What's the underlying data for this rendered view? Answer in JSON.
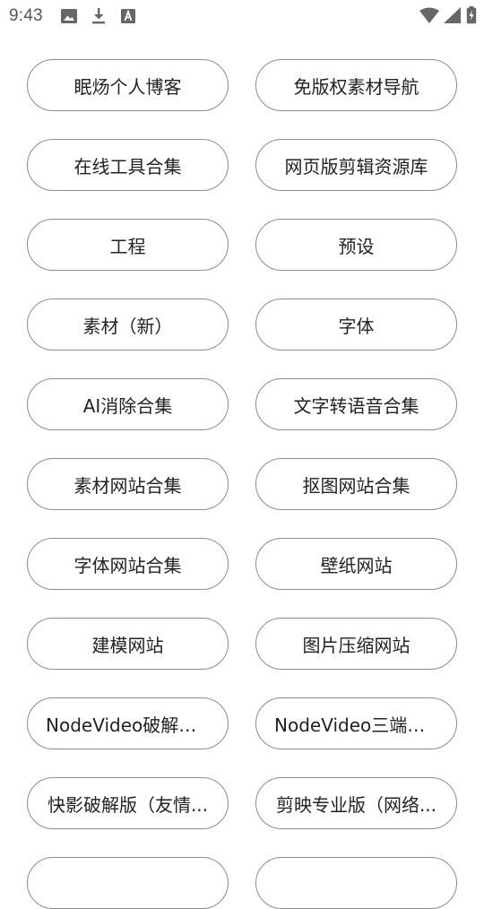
{
  "status_bar": {
    "time": "9:43",
    "left_icons": [
      "image-icon",
      "download-icon",
      "font-a-icon"
    ],
    "right_icons": [
      "wifi-icon",
      "signal-icon",
      "battery-charging-icon"
    ],
    "icon_color": "#666666"
  },
  "items": [
    {
      "label": "眠炀个人博客"
    },
    {
      "label": "免版权素材导航"
    },
    {
      "label": "在线工具合集"
    },
    {
      "label": "网页版剪辑资源库"
    },
    {
      "label": "工程"
    },
    {
      "label": "预设"
    },
    {
      "label": "素材（新）"
    },
    {
      "label": "字体"
    },
    {
      "label": "AI消除合集"
    },
    {
      "label": "文字转语音合集"
    },
    {
      "label": "素材网站合集"
    },
    {
      "label": "抠图网站合集"
    },
    {
      "label": "字体网站合集"
    },
    {
      "label": "壁纸网站"
    },
    {
      "label": "建模网站"
    },
    {
      "label": "图片压缩网站"
    },
    {
      "label": "NodeVideo破解版..."
    },
    {
      "label": "NodeVideo三端破..."
    },
    {
      "label": "快影破解版（友情..."
    },
    {
      "label": "剪映专业版（网络..."
    },
    {
      "label": ""
    },
    {
      "label": ""
    }
  ],
  "colors": {
    "border": "#8c8c8c",
    "text": "#222222",
    "background": "#ffffff"
  }
}
